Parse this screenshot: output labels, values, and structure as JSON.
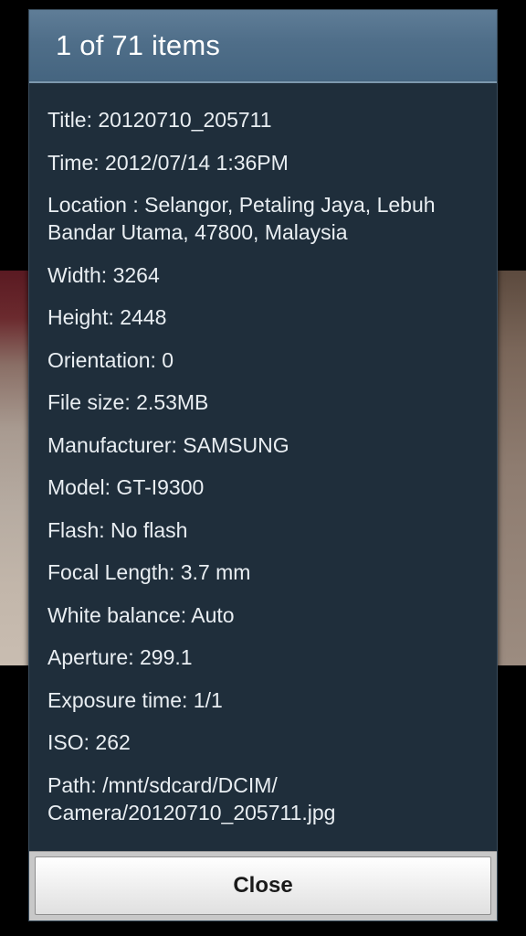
{
  "dialog": {
    "title": "1 of 71 items",
    "details": [
      "Title: 20120710_205711",
      "Time: 2012/07/14 1:36PM",
      "Location : Selangor, Petaling Jaya, Lebuh Bandar Utama, 47800, Malaysia",
      "Width: 3264",
      "Height: 2448",
      "Orientation: 0",
      "File size: 2.53MB",
      "Manufacturer: SAMSUNG",
      "Model: GT-I9300",
      "Flash: No flash",
      "Focal Length: 3.7 mm",
      "White balance: Auto",
      "Aperture: 299.1",
      "Exposure time: 1/1",
      "ISO: 262",
      "Path: /mnt/sdcard/DCIM/ Camera/20120710_205711.jpg"
    ],
    "close_label": "Close"
  },
  "colors": {
    "dialog_background": "#1f2e3b",
    "header_background": "#4f6e89",
    "detail_text": "#e9eef2",
    "button_background": "#f1f1f1"
  }
}
